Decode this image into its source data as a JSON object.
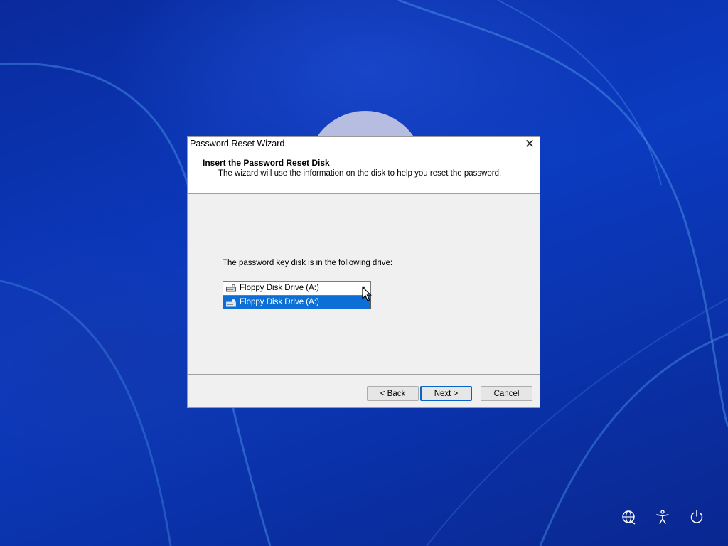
{
  "dialog": {
    "title": "Password Reset Wizard",
    "close_glyph": "✕",
    "header_title": "Insert the Password Reset Disk",
    "header_subtitle": "The wizard will use the information on the disk to help you reset the password.",
    "drive_label": "The password key disk is in the following drive:",
    "drive_select": {
      "selected_value": "Floppy Disk Drive (A:)",
      "options": [
        "Floppy Disk Drive (A:)"
      ],
      "icon": "floppy-drive-icon",
      "expanded": true
    },
    "buttons": {
      "back": "< Back",
      "next": "Next >",
      "cancel": "Cancel"
    }
  },
  "tray": {
    "icons": [
      "network-icon",
      "accessibility-icon",
      "power-icon"
    ]
  },
  "colors": {
    "selection": "#0b6fd6",
    "default_button_border": "#0a63c9",
    "wallpaper": "#0b2a9a"
  }
}
